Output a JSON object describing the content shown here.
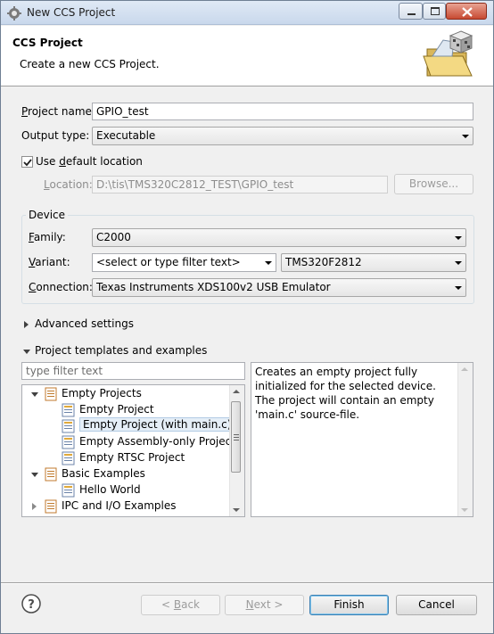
{
  "window": {
    "title": "New CCS Project"
  },
  "header": {
    "title": "CCS Project",
    "description": "Create a new CCS Project.",
    "icon": "folder-wizard-icon"
  },
  "form": {
    "project_name_label_u": "P",
    "project_name_label_rest": "roject name:",
    "project_name_value": "GPIO_test",
    "output_type_label": "Output type:",
    "output_type_value": "Executable",
    "use_default_label_pre": "Use ",
    "use_default_label_u": "d",
    "use_default_label_post": "efault location",
    "use_default_checked": true,
    "location_label_u": "L",
    "location_label_rest": "ocation:",
    "location_value": "D:\\tis\\TMS320C2812_TEST\\GPIO_test",
    "browse_label": "Browse..."
  },
  "device": {
    "group_label": "Device",
    "family_label_u": "F",
    "family_label_rest": "amily:",
    "family_value": "C2000",
    "variant_label_u": "V",
    "variant_label_rest": "ariant:",
    "variant_filter": "<select or type filter text>",
    "variant_value": "TMS320F2812",
    "connection_label_u": "C",
    "connection_label_rest": "onnection:",
    "connection_value": "Texas Instruments XDS100v2 USB Emulator"
  },
  "sections": {
    "advanced_settings": "Advanced settings",
    "project_templates": "Project templates and examples"
  },
  "templates": {
    "filter_placeholder": "type filter text",
    "tree": [
      {
        "label": "Empty Projects",
        "level": 0,
        "expanded": true,
        "icon": "template-folder-icon"
      },
      {
        "label": "Empty Project",
        "level": 1,
        "icon": "project-template-icon"
      },
      {
        "label": "Empty Project (with main.c)",
        "level": 1,
        "icon": "project-template-icon",
        "selected": true
      },
      {
        "label": "Empty Assembly-only Project",
        "level": 1,
        "icon": "project-template-icon"
      },
      {
        "label": "Empty RTSC Project",
        "level": 1,
        "icon": "project-template-icon"
      },
      {
        "label": "Basic Examples",
        "level": 0,
        "expanded": true,
        "icon": "template-folder-icon"
      },
      {
        "label": "Hello World",
        "level": 1,
        "icon": "project-template-icon"
      },
      {
        "label": "IPC and I/O Examples",
        "level": 0,
        "expanded": false,
        "icon": "template-folder-icon"
      }
    ],
    "description": "Creates an empty project fully initialized for the selected device. The project will contain an empty 'main.c' source-file."
  },
  "footer": {
    "help_icon": "help-icon",
    "back_pre": "< ",
    "back_u": "B",
    "back_post": "ack",
    "next_u": "N",
    "next_post": "ext >",
    "finish_label": "Finish",
    "cancel_label": "Cancel"
  }
}
